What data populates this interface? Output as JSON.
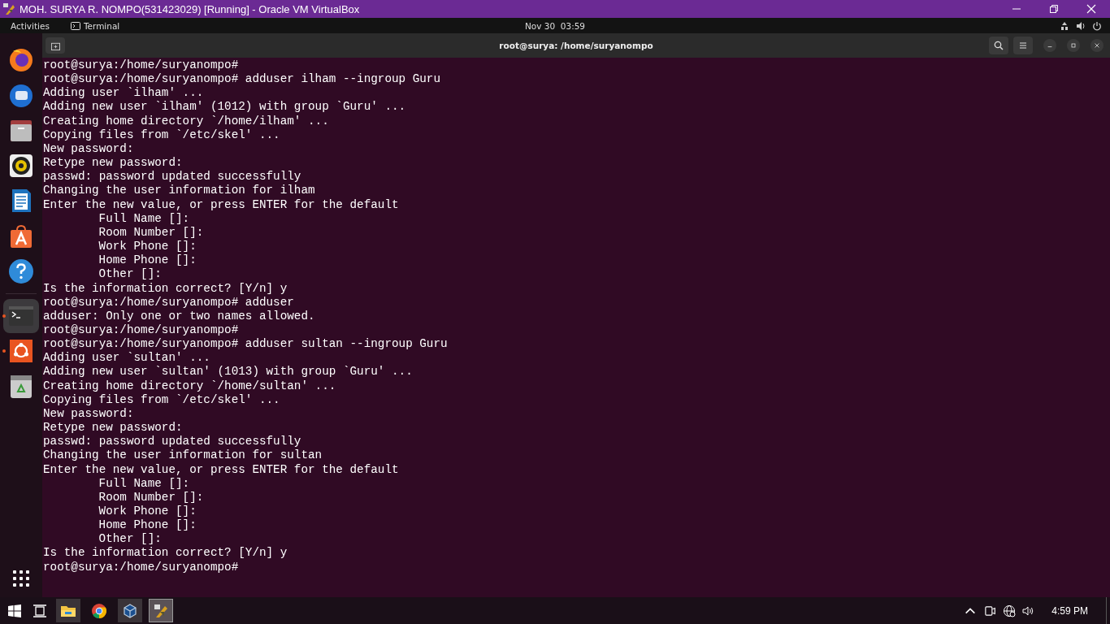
{
  "host_window": {
    "title": "MOH. SURYA R. NOMPO(531423029) [Running] - Oracle VM VirtualBox"
  },
  "top_bar": {
    "activities": "Activities",
    "app": "Terminal",
    "clock": "Nov 30  03:59"
  },
  "dock": [
    {
      "kind": "firefox",
      "running": false,
      "active": false
    },
    {
      "kind": "thunderbird",
      "running": false,
      "active": false
    },
    {
      "kind": "files",
      "running": false,
      "active": false
    },
    {
      "kind": "rhythmbox",
      "running": false,
      "active": false
    },
    {
      "kind": "writer",
      "running": false,
      "active": false
    },
    {
      "kind": "software",
      "running": false,
      "active": false
    },
    {
      "kind": "help",
      "running": false,
      "active": false
    },
    {
      "kind": "terminal",
      "running": true,
      "active": true
    },
    {
      "kind": "ubuntu",
      "running": true,
      "active": false
    },
    {
      "kind": "trash",
      "running": false,
      "active": false
    }
  ],
  "terminal": {
    "title": "root@surya: /home/suryanompo",
    "lines": [
      {
        "text": "root@surya:/home/suryanompo#",
        "indent": false
      },
      {
        "text": "root@surya:/home/suryanompo# adduser ilham --ingroup Guru",
        "indent": false
      },
      {
        "text": "Adding user `ilham' ...",
        "indent": false
      },
      {
        "text": "Adding new user `ilham' (1012) with group `Guru' ...",
        "indent": false
      },
      {
        "text": "Creating home directory `/home/ilham' ...",
        "indent": false
      },
      {
        "text": "Copying files from `/etc/skel' ...",
        "indent": false
      },
      {
        "text": "New password:",
        "indent": false
      },
      {
        "text": "Retype new password:",
        "indent": false
      },
      {
        "text": "passwd: password updated successfully",
        "indent": false
      },
      {
        "text": "Changing the user information for ilham",
        "indent": false
      },
      {
        "text": "Enter the new value, or press ENTER for the default",
        "indent": false
      },
      {
        "text": "Full Name []:",
        "indent": true
      },
      {
        "text": "Room Number []:",
        "indent": true
      },
      {
        "text": "Work Phone []:",
        "indent": true
      },
      {
        "text": "Home Phone []:",
        "indent": true
      },
      {
        "text": "Other []:",
        "indent": true
      },
      {
        "text": "Is the information correct? [Y/n] y",
        "indent": false
      },
      {
        "text": "root@surya:/home/suryanompo# adduser",
        "indent": false
      },
      {
        "text": "adduser: Only one or two names allowed.",
        "indent": false
      },
      {
        "text": "root@surya:/home/suryanompo#",
        "indent": false
      },
      {
        "text": "root@surya:/home/suryanompo# adduser sultan --ingroup Guru",
        "indent": false
      },
      {
        "text": "Adding user `sultan' ...",
        "indent": false
      },
      {
        "text": "Adding new user `sultan' (1013) with group `Guru' ...",
        "indent": false
      },
      {
        "text": "Creating home directory `/home/sultan' ...",
        "indent": false
      },
      {
        "text": "Copying files from `/etc/skel' ...",
        "indent": false
      },
      {
        "text": "New password:",
        "indent": false
      },
      {
        "text": "Retype new password:",
        "indent": false
      },
      {
        "text": "passwd: password updated successfully",
        "indent": false
      },
      {
        "text": "Changing the user information for sultan",
        "indent": false
      },
      {
        "text": "Enter the new value, or press ENTER for the default",
        "indent": false
      },
      {
        "text": "Full Name []:",
        "indent": true
      },
      {
        "text": "Room Number []:",
        "indent": true
      },
      {
        "text": "Work Phone []:",
        "indent": true
      },
      {
        "text": "Home Phone []:",
        "indent": true
      },
      {
        "text": "Other []:",
        "indent": true
      },
      {
        "text": "Is the information correct? [Y/n] y",
        "indent": false
      },
      {
        "text": "root@surya:/home/suryanompo#",
        "indent": false
      }
    ]
  },
  "taskbar": {
    "items": [
      {
        "kind": "explorer",
        "open": true,
        "selected": false
      },
      {
        "kind": "chrome",
        "open": false,
        "selected": false
      },
      {
        "kind": "virtualbox",
        "open": true,
        "selected": false
      },
      {
        "kind": "vm",
        "open": true,
        "selected": true
      }
    ],
    "time": "4:59 PM"
  }
}
